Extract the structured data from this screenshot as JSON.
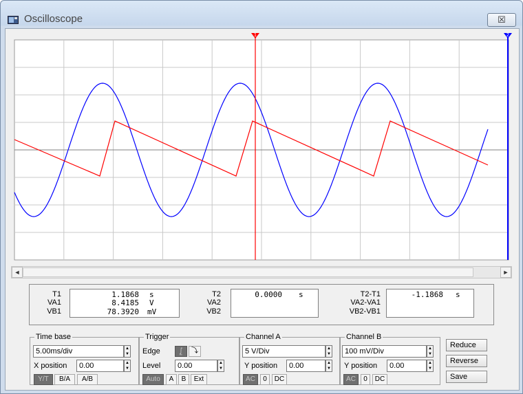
{
  "window": {
    "title": "Oscilloscope",
    "close_glyph": "☒"
  },
  "display": {
    "background": "#ffffff",
    "grid_color": "#c8c8c8",
    "axis_color": "#808080",
    "channel_a_color": "#ff0000",
    "channel_b_color": "#0000ff",
    "cursor1_label": "1",
    "cursor2_label": "2",
    "grid_divisions": {
      "x": 10,
      "y": 8
    }
  },
  "scrollbar": {
    "left_arrow": "◄",
    "right_arrow": "►"
  },
  "readout": {
    "t1": {
      "label": "T1",
      "value": "1.1868",
      "unit": "s"
    },
    "va1": {
      "label": "VA1",
      "value": "8.4185",
      "unit": "V"
    },
    "vb1": {
      "label": "VB1",
      "value": "78.3920",
      "unit": "mV"
    },
    "t2": {
      "label": "T2",
      "value": "0.0000",
      "unit": "s"
    },
    "va2": {
      "label": "VA2"
    },
    "vb2": {
      "label": "VB2"
    },
    "t2t1": {
      "label": "T2-T1",
      "value": "-1.1868",
      "unit": "s"
    },
    "va2va1": {
      "label": "VA2-VA1"
    },
    "vb2vb1": {
      "label": "VB2-VB1"
    }
  },
  "timebase": {
    "title": "Time base",
    "scale": "5.00ms/div",
    "xpos_label": "X position",
    "xpos": "0.00",
    "btn_yt": "Y/T",
    "btn_ba": "B/A",
    "btn_ab": "A/B"
  },
  "trigger": {
    "title": "Trigger",
    "edge_label": "Edge",
    "edge_rise": "⨜",
    "edge_fall": "⤵",
    "level_label": "Level",
    "level": "0.00",
    "btn_auto": "Auto",
    "btn_a": "A",
    "btn_b": "B",
    "btn_ext": "Ext"
  },
  "channel_a": {
    "title": "Channel A",
    "scale": "5  V/Div",
    "ypos_label": "Y position",
    "ypos": "0.00",
    "btn_ac": "AC",
    "btn_0": "0",
    "btn_dc": "DC"
  },
  "channel_b": {
    "title": "Channel B",
    "scale": "100 mV/Div",
    "ypos_label": "Y position",
    "ypos": "0.00",
    "btn_ac": "AC",
    "btn_0": "0",
    "btn_dc": "DC"
  },
  "actions": {
    "reduce": "Reduce",
    "reverse": "Reverse",
    "save": "Save"
  },
  "spin_glyphs": {
    "up": "▲",
    "down": "▼"
  }
}
